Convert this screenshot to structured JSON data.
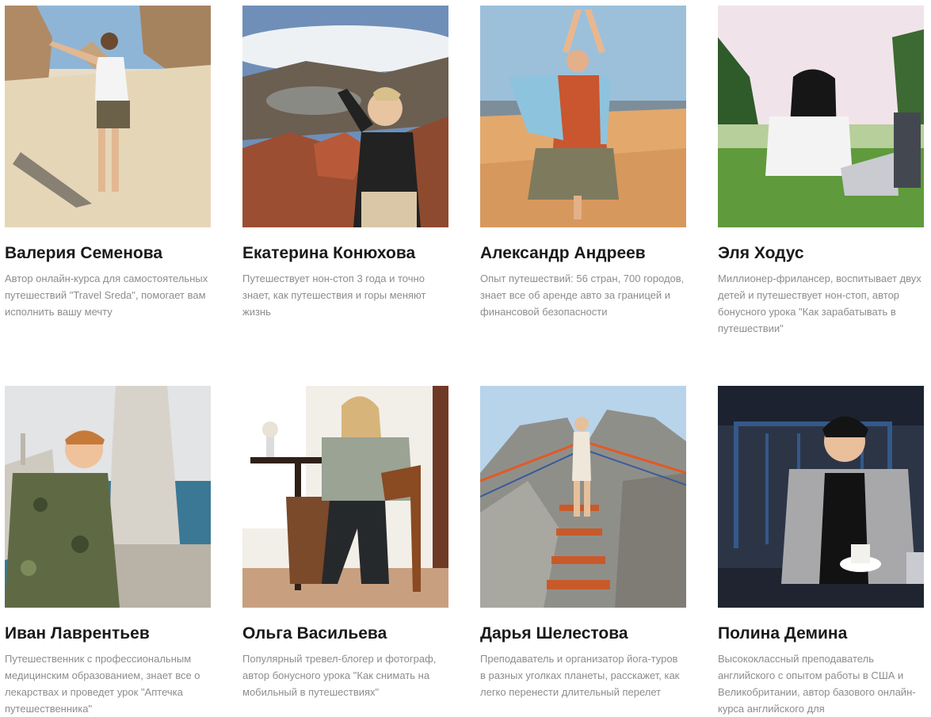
{
  "experts": [
    {
      "name": "Валерия Семенова",
      "description": "Автор онлайн-курса для самостоятельных путешествий \"Travel Sreda\", помогает вам исполнить вашу мечту",
      "photo_alt": "Фото: Валерия Семенова"
    },
    {
      "name": "Екатерина Конюхова",
      "description": "Путешествует нон-стоп 3 года и точно знает, как путешествия и горы меняют жизнь",
      "photo_alt": "Фото: Екатерина Конюхова"
    },
    {
      "name": "Александр Андреев",
      "description": "Опыт путешествий: 56 стран, 700 городов, знает все об аренде авто за границей и финансовой безопасности",
      "photo_alt": "Фото: Александр Андреев"
    },
    {
      "name": "Эля Ходус",
      "description": "Миллионер-фрилансер, воспитывает двух детей и путешествует нон-стоп, автор бонусного урока \"Как зарабатывать в путешествии\"",
      "photo_alt": "Фото: Эля Ходус"
    },
    {
      "name": "Иван Лаврентьев",
      "description": "Путешественник с профессиональным медицинским образованием, знает все о лекарствах и проведет урок \"Аптечка путешественника\"",
      "photo_alt": "Фото: Иван Лаврентьев"
    },
    {
      "name": "Ольга Васильева",
      "description": "Популярный тревел-блогер и фотограф, автор бонусного урока \"Как снимать на мобильный в путешествиях\"",
      "photo_alt": "Фото: Ольга Васильева"
    },
    {
      "name": "Дарья Шелестова",
      "description": "Преподаватель и организатор йога-туров в разных уголках планеты, расскажет, как легко перенести длительный перелет",
      "photo_alt": "Фото: Дарья Шелестова"
    },
    {
      "name": "Полина Демина",
      "description": "Высококлассный преподаватель английского с опытом работы в США и Великобритании, автор базового онлайн-курса английского для",
      "photo_alt": "Фото: Полина Демина"
    }
  ]
}
